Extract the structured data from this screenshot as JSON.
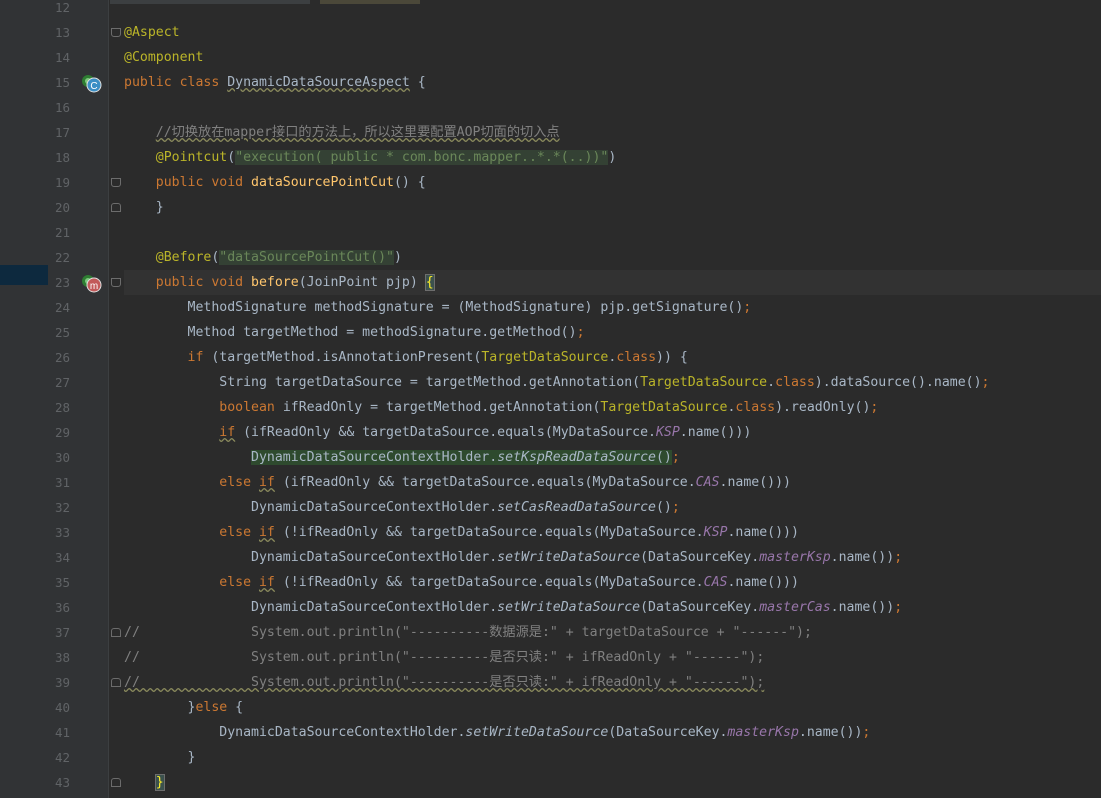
{
  "editor": {
    "lines": [
      {
        "num": "12",
        "tokens": []
      },
      {
        "num": "13",
        "tokens": [
          {
            "t": "@Aspect",
            "c": "ann"
          }
        ]
      },
      {
        "num": "14",
        "tokens": [
          {
            "t": "@Component",
            "c": "ann"
          }
        ]
      },
      {
        "num": "15",
        "tokens": [
          {
            "t": "public class ",
            "c": "kw"
          },
          {
            "t": "DynamicDataSourceAspect",
            "c": "wavy"
          },
          {
            "t": " {"
          }
        ]
      },
      {
        "num": "16",
        "tokens": []
      },
      {
        "num": "17",
        "tokens": [
          {
            "t": "    "
          },
          {
            "t": "//切换放在mapper接口的方法上，所以这里要配置AOP切面的切入点",
            "c": "cmt wavy"
          }
        ]
      },
      {
        "num": "18",
        "tokens": [
          {
            "t": "    "
          },
          {
            "t": "@Pointcut",
            "c": "ann"
          },
          {
            "t": "("
          },
          {
            "t": "\"execution( public * com.bonc.mapper..*.*(..))\"",
            "c": "str hlgreen"
          },
          {
            "t": ")"
          }
        ]
      },
      {
        "num": "19",
        "tokens": [
          {
            "t": "    "
          },
          {
            "t": "public void ",
            "c": "kw"
          },
          {
            "t": "dataSourcePointCut",
            "c": "meth"
          },
          {
            "t": "() {"
          }
        ]
      },
      {
        "num": "20",
        "tokens": [
          {
            "t": "    }"
          }
        ]
      },
      {
        "num": "21",
        "tokens": []
      },
      {
        "num": "22",
        "tokens": [
          {
            "t": "    "
          },
          {
            "t": "@Before",
            "c": "ann"
          },
          {
            "t": "("
          },
          {
            "t": "\"dataSourcePointCut()\"",
            "c": "str hlgreen"
          },
          {
            "t": ")"
          }
        ]
      },
      {
        "num": "23",
        "tokens": [
          {
            "t": "    "
          },
          {
            "t": "public void ",
            "c": "kw"
          },
          {
            "t": "before",
            "c": "meth"
          },
          {
            "t": "(JoinPoint pjp) "
          },
          {
            "t": "{",
            "c": "braceh"
          }
        ]
      },
      {
        "num": "24",
        "tokens": [
          {
            "t": "        MethodSignature methodSignature = (MethodSignature) pjp.getSignature()"
          },
          {
            "t": ";",
            "c": "kw"
          }
        ]
      },
      {
        "num": "25",
        "tokens": [
          {
            "t": "        Method targetMethod = methodSignature.getMethod()"
          },
          {
            "t": ";",
            "c": "kw"
          }
        ]
      },
      {
        "num": "26",
        "tokens": [
          {
            "t": "        "
          },
          {
            "t": "if ",
            "c": "kw"
          },
          {
            "t": "(targetMethod.isAnnotationPresent("
          },
          {
            "t": "TargetDataSource",
            "c": "ann"
          },
          {
            "t": "."
          },
          {
            "t": "class",
            "c": "kw"
          },
          {
            "t": ")) {"
          }
        ]
      },
      {
        "num": "27",
        "tokens": [
          {
            "t": "            String targetDataSource = targetMethod.getAnnotation("
          },
          {
            "t": "TargetDataSource",
            "c": "ann"
          },
          {
            "t": "."
          },
          {
            "t": "class",
            "c": "kw"
          },
          {
            "t": ").dataSource().name()"
          },
          {
            "t": ";",
            "c": "kw"
          }
        ]
      },
      {
        "num": "28",
        "tokens": [
          {
            "t": "            "
          },
          {
            "t": "boolean ",
            "c": "kw"
          },
          {
            "t": "ifReadOnly = targetMethod.getAnnotation("
          },
          {
            "t": "TargetDataSource",
            "c": "ann"
          },
          {
            "t": "."
          },
          {
            "t": "class",
            "c": "kw"
          },
          {
            "t": ").readOnly()"
          },
          {
            "t": ";",
            "c": "kw"
          }
        ]
      },
      {
        "num": "29",
        "tokens": [
          {
            "t": "            "
          },
          {
            "t": "if",
            "c": "kw wavy"
          },
          {
            "t": " (ifReadOnly && targetDataSource.equals(MyDataSource."
          },
          {
            "t": "KSP",
            "c": "stat"
          },
          {
            "t": ".name()))"
          }
        ]
      },
      {
        "num": "30",
        "tokens": [
          {
            "t": "                "
          },
          {
            "t": "DynamicDataSourceContextHolder.",
            "c": "hlgreen2"
          },
          {
            "t": "setKspReadDataSource",
            "c": "ital hlgreen2"
          },
          {
            "t": "()",
            "c": "hlgreen2"
          },
          {
            "t": ";",
            "c": "kw"
          }
        ]
      },
      {
        "num": "31",
        "tokens": [
          {
            "t": "            "
          },
          {
            "t": "else ",
            "c": "kw"
          },
          {
            "t": "if",
            "c": "kw wavy"
          },
          {
            "t": " (ifReadOnly && targetDataSource.equals(MyDataSource."
          },
          {
            "t": "CAS",
            "c": "stat"
          },
          {
            "t": ".name()))"
          }
        ]
      },
      {
        "num": "32",
        "tokens": [
          {
            "t": "                DynamicDataSourceContextHolder."
          },
          {
            "t": "setCasReadDataSource",
            "c": "ital"
          },
          {
            "t": "()"
          },
          {
            "t": ";",
            "c": "kw"
          }
        ]
      },
      {
        "num": "33",
        "tokens": [
          {
            "t": "            "
          },
          {
            "t": "else ",
            "c": "kw"
          },
          {
            "t": "if",
            "c": "kw wavy"
          },
          {
            "t": " (!ifReadOnly && targetDataSource.equals(MyDataSource."
          },
          {
            "t": "KSP",
            "c": "stat"
          },
          {
            "t": ".name()))"
          }
        ]
      },
      {
        "num": "34",
        "tokens": [
          {
            "t": "                DynamicDataSourceContextHolder."
          },
          {
            "t": "setWriteDataSource",
            "c": "ital"
          },
          {
            "t": "(DataSourceKey."
          },
          {
            "t": "masterKsp",
            "c": "stat"
          },
          {
            "t": ".name())"
          },
          {
            "t": ";",
            "c": "kw"
          }
        ]
      },
      {
        "num": "35",
        "tokens": [
          {
            "t": "            "
          },
          {
            "t": "else ",
            "c": "kw"
          },
          {
            "t": "if",
            "c": "kw wavy"
          },
          {
            "t": " (!ifReadOnly && targetDataSource.equals(MyDataSource."
          },
          {
            "t": "CAS",
            "c": "stat"
          },
          {
            "t": ".name()))"
          }
        ]
      },
      {
        "num": "36",
        "tokens": [
          {
            "t": "                DynamicDataSourceContextHolder."
          },
          {
            "t": "setWriteDataSource",
            "c": "ital"
          },
          {
            "t": "(DataSourceKey."
          },
          {
            "t": "masterCas",
            "c": "stat"
          },
          {
            "t": ".name())"
          },
          {
            "t": ";",
            "c": "kw"
          }
        ]
      },
      {
        "num": "37",
        "tokens": [
          {
            "t": "//              System.out.println(\"----------数据源是:\" + targetDataSource + \"------\");",
            "c": "cmt"
          }
        ]
      },
      {
        "num": "38",
        "tokens": [
          {
            "t": "//              System.out.println(\"----------是否只读:\" + ifReadOnly + \"------\");",
            "c": "cmt"
          }
        ]
      },
      {
        "num": "39",
        "tokens": [
          {
            "t": "//              System.out.println(\"----------是否只读:\" + ifReadOnly + \"------\");",
            "c": "cmt wavy"
          }
        ]
      },
      {
        "num": "40",
        "tokens": [
          {
            "t": "        }"
          },
          {
            "t": "else ",
            "c": "kw"
          },
          {
            "t": "{"
          }
        ]
      },
      {
        "num": "41",
        "tokens": [
          {
            "t": "            DynamicDataSourceContextHolder."
          },
          {
            "t": "setWriteDataSource",
            "c": "ital"
          },
          {
            "t": "(DataSourceKey."
          },
          {
            "t": "masterKsp",
            "c": "stat"
          },
          {
            "t": ".name())"
          },
          {
            "t": ";",
            "c": "kw"
          }
        ]
      },
      {
        "num": "42",
        "tokens": [
          {
            "t": "        }"
          }
        ]
      },
      {
        "num": "43",
        "tokens": [
          {
            "t": "    "
          },
          {
            "t": "}",
            "c": "braceh"
          }
        ]
      }
    ],
    "gutter_icons": [
      {
        "line": "15",
        "name": "class-c-icon",
        "label": "C"
      },
      {
        "line": "23",
        "name": "method-m-icon",
        "label": "m"
      }
    ]
  }
}
